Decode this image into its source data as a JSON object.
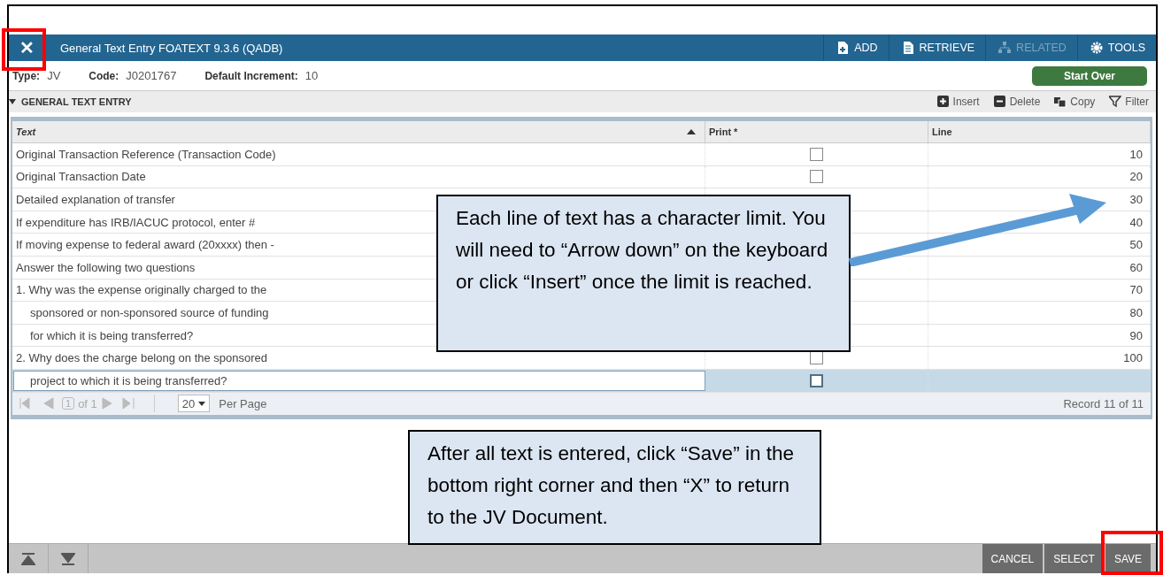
{
  "window": {
    "close": "✕",
    "title": "General Text Entry FOATEXT 9.3.6 (QADB)"
  },
  "toolbar": [
    {
      "label": "ADD",
      "kind": "add",
      "disabled": false
    },
    {
      "label": "RETRIEVE",
      "kind": "retrieve",
      "disabled": false
    },
    {
      "label": "RELATED",
      "kind": "related",
      "disabled": true
    },
    {
      "label": "TOOLS",
      "kind": "tools",
      "disabled": false
    }
  ],
  "key_block": {
    "fields": [
      {
        "label": "Type:",
        "value": "JV"
      },
      {
        "label": "Code:",
        "value": "J0201767"
      },
      {
        "label": "Default Increment:",
        "value": "10"
      }
    ],
    "start_over": "Start Over"
  },
  "section": {
    "title": "GENERAL TEXT ENTRY",
    "actions": [
      {
        "label": "Insert",
        "kind": "insert"
      },
      {
        "label": "Delete",
        "kind": "delete"
      },
      {
        "label": "Copy",
        "kind": "copy"
      },
      {
        "label": "Filter",
        "kind": "filter"
      }
    ]
  },
  "table": {
    "columns": [
      {
        "label": "Text",
        "sorted": true
      },
      {
        "label": "Print *",
        "sorted": false
      },
      {
        "label": "Line",
        "sorted": false
      }
    ],
    "rows": [
      {
        "text": "Original Transaction Reference (Transaction Code)",
        "indented": false,
        "print": false,
        "line": "10",
        "selected": false
      },
      {
        "text": "Original Transaction Date",
        "indented": false,
        "print": false,
        "line": "20",
        "selected": false
      },
      {
        "text": "Detailed explanation of transfer",
        "indented": false,
        "line": "30",
        "selected": false
      },
      {
        "text": "If expenditure has IRB/IACUC protocol, enter #",
        "indented": false,
        "line": "40",
        "selected": false
      },
      {
        "text": "If moving expense to federal award (20xxxx) then -",
        "indented": false,
        "line": "50",
        "selected": false
      },
      {
        "text": "Answer the following two questions",
        "indented": false,
        "line": "60",
        "selected": false
      },
      {
        "text": "1. Why was the expense originally charged to the",
        "indented": false,
        "line": "70",
        "selected": false
      },
      {
        "text": "sponsored or non-sponsored source of funding",
        "indented": true,
        "line": "80",
        "selected": false
      },
      {
        "text": "for which it is being transferred?",
        "indented": true,
        "line": "90",
        "selected": false
      },
      {
        "text": "2. Why does the charge belong on the sponsored",
        "indented": false,
        "print": false,
        "line": "100",
        "selected": false
      },
      {
        "text": "project to which it is being transferred?",
        "indented": true,
        "print": false,
        "line": "",
        "selected": true
      }
    ]
  },
  "pager": {
    "page": "1",
    "of": "of 1",
    "per_page": "20",
    "per_page_label": "Per Page",
    "record": "Record 11 of 11"
  },
  "footer": {
    "buttons": [
      "CANCEL",
      "SELECT",
      "SAVE"
    ]
  },
  "callouts": [
    {
      "text": "Each line of text has a character limit. You will need to “Arrow down” on the keyboard or click “Insert” once the limit is reached.",
      "pointer": true
    },
    {
      "text": "After all text is entered, click “Save” in the bottom right corner and then “X” to return to the JV Document.",
      "pointer": false
    }
  ]
}
